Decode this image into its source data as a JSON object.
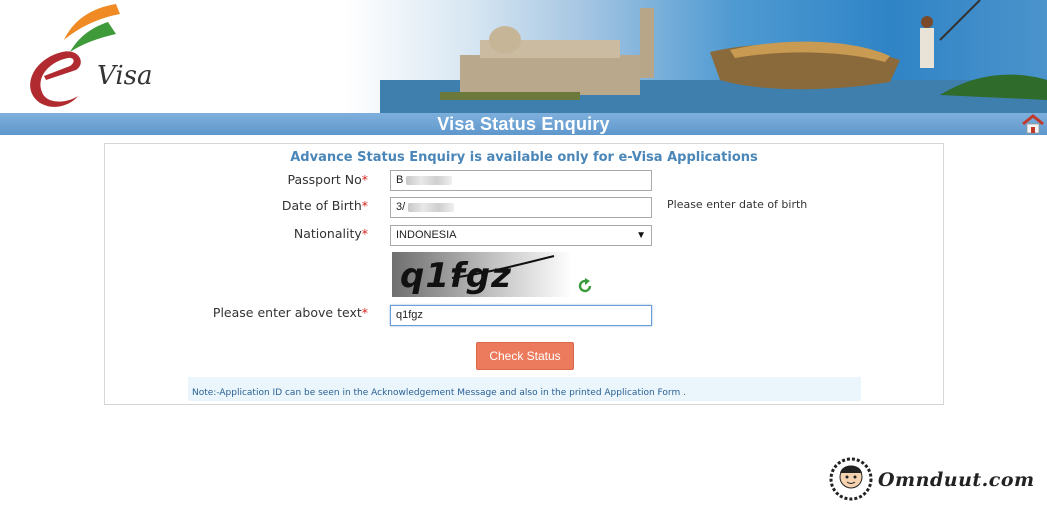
{
  "banner": {
    "logo_text": "Visa"
  },
  "title": "Visa Status Enquiry",
  "panel": {
    "heading": "Advance Status Enquiry is available only for e-Visa Applications",
    "required_mark": "*",
    "passport": {
      "label": "Passport No",
      "value_prefix": "B"
    },
    "dob": {
      "label": "Date of Birth",
      "value_prefix": "3/",
      "hint": "Please enter date of birth"
    },
    "nationality": {
      "label": "Nationality",
      "selected": "INDONESIA"
    },
    "captcha": {
      "image_text": "q1fgz",
      "label": "Please enter above text",
      "value": "q1fgz"
    },
    "submit_label": "Check Status",
    "note": "Note:-Application ID can be seen in the Acknowledgement Message and also in the printed Application Form ."
  },
  "watermark": {
    "text": "Omnduut.com"
  },
  "colors": {
    "title_bar": "#6ba3d6",
    "button": "#ec7a5c",
    "heading": "#4a86b8",
    "required": "#d9231c"
  }
}
